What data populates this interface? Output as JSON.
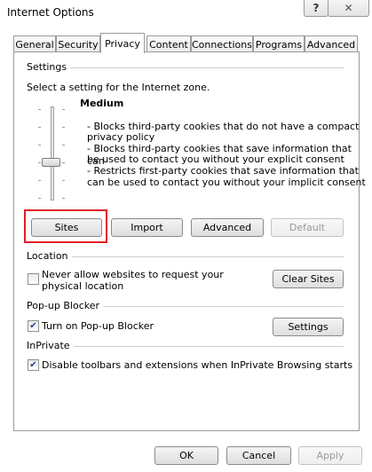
{
  "window": {
    "title": "Internet Options",
    "help_glyph": "?",
    "close_glyph": "✕"
  },
  "tabs": [
    {
      "label": "General",
      "active": false
    },
    {
      "label": "Security",
      "active": false
    },
    {
      "label": "Privacy",
      "active": true
    },
    {
      "label": "Content",
      "active": false
    },
    {
      "label": "Connections",
      "active": false
    },
    {
      "label": "Programs",
      "active": false
    },
    {
      "label": "Advanced",
      "active": false
    }
  ],
  "settings": {
    "group_label": "Settings",
    "zone_prompt": "Select a setting for the Internet zone.",
    "level_name": "Medium",
    "descriptions": [
      "- Blocks third-party cookies that do not have a compact",
      "privacy policy",
      "- Blocks third-party cookies that save information that can",
      "be used to contact you without your explicit consent",
      "- Restricts first-party cookies that save information that",
      "can be used to contact you without your implicit consent"
    ],
    "slider_level_index": 2,
    "slider_level_count": 6,
    "buttons": {
      "sites": "Sites",
      "import": "Import",
      "advanced": "Advanced",
      "default": "Default"
    }
  },
  "location": {
    "group_label": "Location",
    "checkbox_label_line1": "Never allow websites to request your",
    "checkbox_label_line2": "physical location",
    "checked": false,
    "clear_button": "Clear Sites"
  },
  "popup": {
    "group_label": "Pop-up Blocker",
    "checkbox_label": "Turn on Pop-up Blocker",
    "checked": true,
    "settings_button": "Settings"
  },
  "inprivate": {
    "group_label": "InPrivate",
    "checkbox_label": "Disable toolbars and extensions when InPrivate Browsing starts",
    "checked": true
  },
  "footer": {
    "ok": "OK",
    "cancel": "Cancel",
    "apply": "Apply"
  },
  "check_glyph": "✔",
  "accent_colors": {
    "highlight_border": "#e0202a",
    "check_mark": "#1b3f8b"
  }
}
